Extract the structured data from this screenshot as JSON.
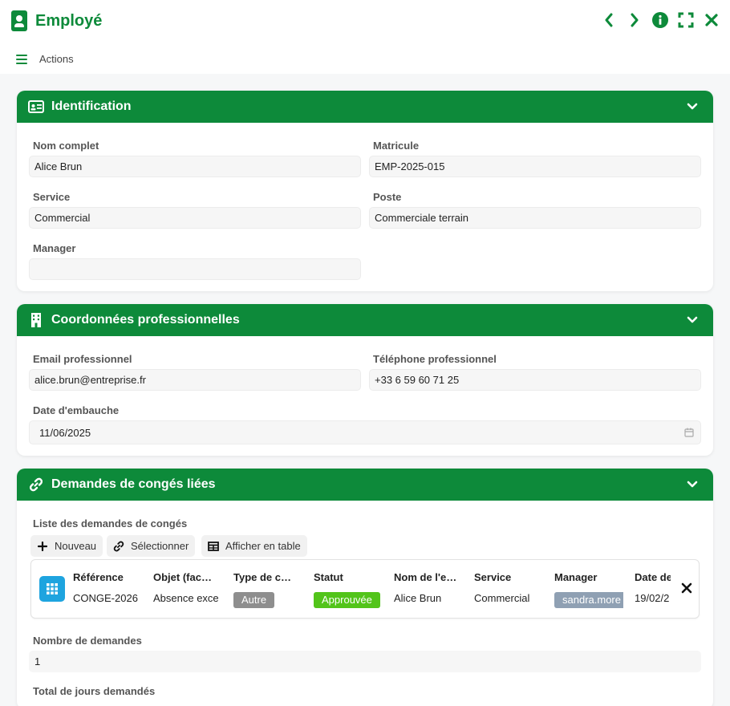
{
  "window": {
    "title": "Employé",
    "actions_label": "Actions"
  },
  "identification": {
    "header": "Identification",
    "nom_complet_label": "Nom complet",
    "nom_complet_value": "Alice Brun",
    "matricule_label": "Matricule",
    "matricule_value": "EMP-2025-015",
    "service_label": "Service",
    "service_value": "Commercial",
    "poste_label": "Poste",
    "poste_value": "Commerciale terrain",
    "manager_label": "Manager",
    "manager_value": ""
  },
  "coordonnees": {
    "header": "Coordonnées professionnelles",
    "email_label": "Email professionnel",
    "email_value": "alice.brun@entreprise.fr",
    "telephone_label": "Téléphone professionnel",
    "telephone_value": "+33 6 59 60 71 25",
    "date_label": "Date d'embauche",
    "date_value": "11/06/2025"
  },
  "conges": {
    "header": "Demandes de congés liées",
    "list_label": "Liste des demandes de congés",
    "btn_nouveau": "Nouveau",
    "btn_selectionner": "Sélectionner",
    "btn_afficher_table": "Afficher en table",
    "columns": [
      "Référence",
      "Objet (fac…",
      "Type de c…",
      "Statut",
      "Nom de l'e…",
      "Service",
      "Manager",
      "Date de"
    ],
    "row": {
      "reference": "CONGE-2026",
      "objet": "Absence exce",
      "type": "Autre",
      "statut": "Approuvée",
      "nom": "Alice Brun",
      "service": "Commercial",
      "manager": "sandra.more",
      "date": "19/02/2"
    },
    "nombre_label": "Nombre de demandes",
    "nombre_value": "1",
    "total_label": "Total de jours demandés"
  },
  "colors": {
    "brand": "#0d8a3a",
    "badge_grey": "#8e8e8e",
    "badge_green": "#52c41a",
    "badge_slate": "#8fa0b3",
    "grid_blue": "#1ea4df"
  }
}
